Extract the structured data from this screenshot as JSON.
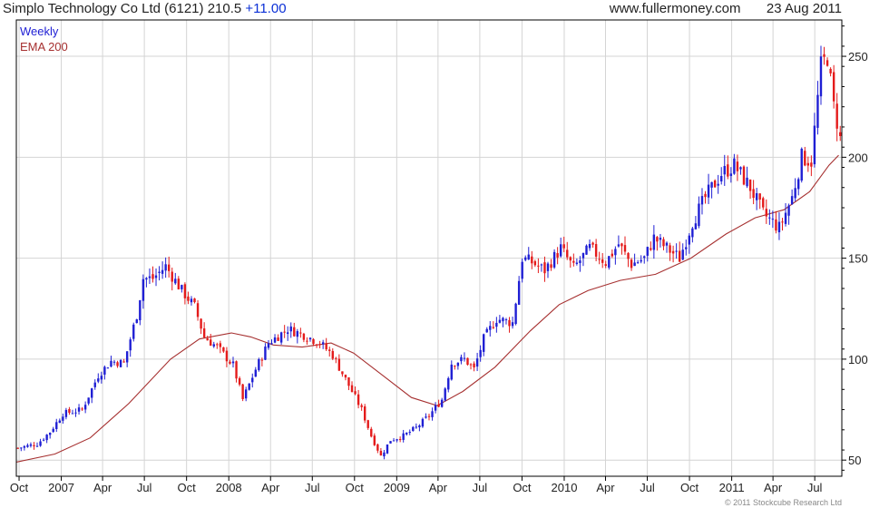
{
  "header": {
    "title": "Simplo Technology Co Ltd (6121)",
    "price": "210.5",
    "change": "+11.00",
    "site": "www.fullermoney.com",
    "date": "23 Aug 2011"
  },
  "legend": {
    "frequency": "Weekly",
    "indicator": "EMA 200"
  },
  "copyright": "© 2011 Stockcube Research Ltd",
  "colors": {
    "up": "#1f1fd4",
    "down": "#e41b1b",
    "ema": "#a63030",
    "grid": "#d4d4d4",
    "frame": "#000000"
  },
  "chart_data": {
    "type": "candlestick",
    "frequency": "weekly",
    "title": "Simplo Technology Co Ltd (6121)",
    "ylim": [
      42,
      268
    ],
    "yticks": [
      50,
      100,
      150,
      200,
      250
    ],
    "xlim": [
      "2006-09-25",
      "2011-08-29"
    ],
    "xticks": [
      {
        "label": "Oct",
        "date": "2006-10-01"
      },
      {
        "label": "2007",
        "date": "2007-01-01"
      },
      {
        "label": "Apr",
        "date": "2007-04-01"
      },
      {
        "label": "Jul",
        "date": "2007-07-01"
      },
      {
        "label": "Oct",
        "date": "2007-10-01"
      },
      {
        "label": "2008",
        "date": "2008-01-01"
      },
      {
        "label": "Apr",
        "date": "2008-04-01"
      },
      {
        "label": "Jul",
        "date": "2008-07-01"
      },
      {
        "label": "Oct",
        "date": "2008-10-01"
      },
      {
        "label": "2009",
        "date": "2009-01-01"
      },
      {
        "label": "Apr",
        "date": "2009-04-01"
      },
      {
        "label": "Jul",
        "date": "2009-07-01"
      },
      {
        "label": "Oct",
        "date": "2009-10-01"
      },
      {
        "label": "2010",
        "date": "2010-01-01"
      },
      {
        "label": "Apr",
        "date": "2010-04-01"
      },
      {
        "label": "Jul",
        "date": "2010-07-01"
      },
      {
        "label": "Oct",
        "date": "2010-10-01"
      },
      {
        "label": "2011",
        "date": "2011-01-01"
      },
      {
        "label": "Apr",
        "date": "2011-04-01"
      },
      {
        "label": "Jul",
        "date": "2011-07-01"
      }
    ],
    "close_path": [
      [
        "2006-09-25",
        56
      ],
      [
        "2006-11-06",
        58
      ],
      [
        "2006-12-04",
        64
      ],
      [
        "2007-01-01",
        73
      ],
      [
        "2007-02-12",
        75
      ],
      [
        "2007-03-19",
        92
      ],
      [
        "2007-04-16",
        99
      ],
      [
        "2007-05-14",
        98
      ],
      [
        "2007-06-11",
        122
      ],
      [
        "2007-06-25",
        140
      ],
      [
        "2007-07-16",
        140
      ],
      [
        "2007-08-13",
        146
      ],
      [
        "2007-09-17",
        134
      ],
      [
        "2007-10-15",
        126
      ],
      [
        "2007-11-05",
        111
      ],
      [
        "2007-12-03",
        106
      ],
      [
        "2008-01-07",
        97
      ],
      [
        "2008-01-28",
        80
      ],
      [
        "2008-02-25",
        95
      ],
      [
        "2008-03-24",
        108
      ],
      [
        "2008-05-05",
        115
      ],
      [
        "2008-06-09",
        112
      ],
      [
        "2008-07-14",
        108
      ],
      [
        "2008-08-11",
        102
      ],
      [
        "2008-09-08",
        90
      ],
      [
        "2008-10-13",
        75
      ],
      [
        "2008-11-03",
        62
      ],
      [
        "2008-11-24",
        52
      ],
      [
        "2008-12-15",
        60
      ],
      [
        "2009-01-12",
        62
      ],
      [
        "2009-02-09",
        66
      ],
      [
        "2009-03-09",
        72
      ],
      [
        "2009-04-06",
        80
      ],
      [
        "2009-04-27",
        98
      ],
      [
        "2009-05-25",
        100
      ],
      [
        "2009-06-15",
        95
      ],
      [
        "2009-07-06",
        110
      ],
      [
        "2009-08-03",
        120
      ],
      [
        "2009-09-07",
        118
      ],
      [
        "2009-09-28",
        150
      ],
      [
        "2009-10-19",
        148
      ],
      [
        "2009-11-16",
        144
      ],
      [
        "2009-12-21",
        155
      ],
      [
        "2010-01-18",
        145
      ],
      [
        "2010-02-22",
        155
      ],
      [
        "2010-03-29",
        148
      ],
      [
        "2010-04-26",
        157
      ],
      [
        "2010-05-24",
        147
      ],
      [
        "2010-06-21",
        150
      ],
      [
        "2010-07-12",
        160
      ],
      [
        "2010-08-09",
        155
      ],
      [
        "2010-09-06",
        150
      ],
      [
        "2010-10-04",
        168
      ],
      [
        "2010-11-01",
        180
      ],
      [
        "2010-12-06",
        192
      ],
      [
        "2011-01-03",
        196
      ],
      [
        "2011-02-07",
        185
      ],
      [
        "2011-03-07",
        172
      ],
      [
        "2011-04-11",
        165
      ],
      [
        "2011-05-09",
        180
      ],
      [
        "2011-05-30",
        200
      ],
      [
        "2011-06-20",
        198
      ],
      [
        "2011-07-11",
        245
      ],
      [
        "2011-07-25",
        250
      ],
      [
        "2011-08-08",
        225
      ],
      [
        "2011-08-22",
        210.5
      ]
    ],
    "ema200_path": [
      [
        "2006-09-25",
        49
      ],
      [
        "2006-12-18",
        53
      ],
      [
        "2007-03-05",
        61
      ],
      [
        "2007-05-28",
        78
      ],
      [
        "2007-08-27",
        100
      ],
      [
        "2007-10-29",
        110
      ],
      [
        "2008-01-07",
        113
      ],
      [
        "2008-02-18",
        111
      ],
      [
        "2008-04-07",
        107
      ],
      [
        "2008-06-09",
        106
      ],
      [
        "2008-08-11",
        108
      ],
      [
        "2008-09-29",
        103
      ],
      [
        "2008-12-01",
        92
      ],
      [
        "2009-02-02",
        81
      ],
      [
        "2009-03-30",
        77
      ],
      [
        "2009-05-25",
        84
      ],
      [
        "2009-08-03",
        96
      ],
      [
        "2009-10-19",
        114
      ],
      [
        "2009-12-21",
        127
      ],
      [
        "2010-02-22",
        134
      ],
      [
        "2010-05-03",
        139
      ],
      [
        "2010-07-19",
        142
      ],
      [
        "2010-10-04",
        150
      ],
      [
        "2010-12-20",
        162
      ],
      [
        "2011-02-21",
        170
      ],
      [
        "2011-04-25",
        174
      ],
      [
        "2011-06-20",
        183
      ],
      [
        "2011-08-01",
        196
      ],
      [
        "2011-08-22",
        201
      ]
    ]
  }
}
